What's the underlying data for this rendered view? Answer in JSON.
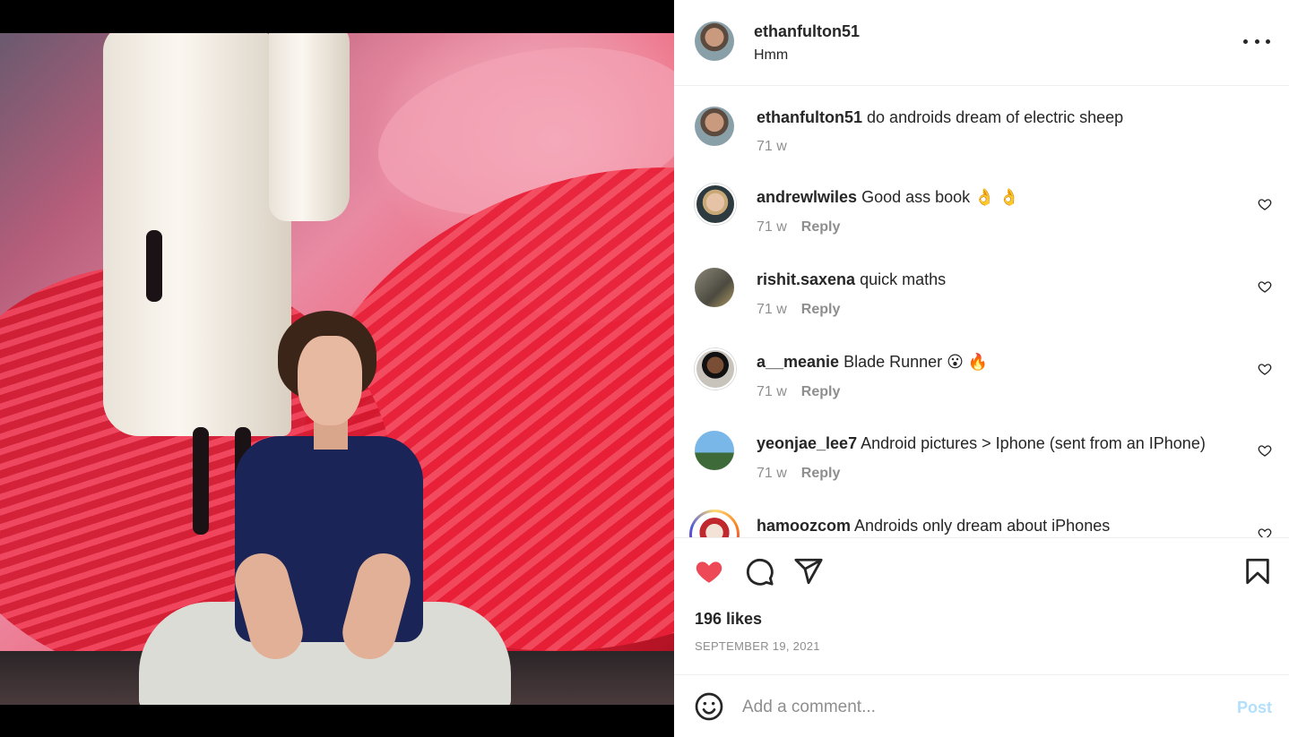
{
  "post": {
    "username": "ethanfulton51",
    "subtitle": "Hmm"
  },
  "caption": {
    "username": "ethanfulton51",
    "text": "do androids dream of electric sheep",
    "age": "71 w"
  },
  "comments": [
    {
      "username": "andrewlwiles",
      "text": "Good ass book 👌 👌",
      "age": "71 w",
      "reply": "Reply"
    },
    {
      "username": "rishit.saxena",
      "text": "quick maths",
      "age": "71 w",
      "reply": "Reply"
    },
    {
      "username": "a__meanie",
      "text": "Blade Runner 😮 🔥",
      "age": "71 w",
      "reply": "Reply"
    },
    {
      "username": "yeonjae_lee7",
      "text": "Android pictures > Iphone (sent from an IPhone)",
      "age": "71 w",
      "reply": "Reply"
    },
    {
      "username": "hamoozcom",
      "text": "Androids only dream about iPhones",
      "age": "",
      "reply": ""
    }
  ],
  "stats": {
    "likes": "196 likes",
    "date": "SEPTEMBER 19, 2021"
  },
  "composer": {
    "placeholder": "Add a comment...",
    "post_label": "Post"
  },
  "colors": {
    "like_red": "#ed4956",
    "post_disabled": "#b2dffc",
    "meta_gray": "#8e8e8e"
  },
  "icons": {
    "like": "heart-filled-icon",
    "comment": "comment-bubble-icon",
    "share": "paper-plane-icon",
    "save": "bookmark-icon",
    "emoji": "smiley-icon",
    "more": "ellipsis-icon"
  }
}
